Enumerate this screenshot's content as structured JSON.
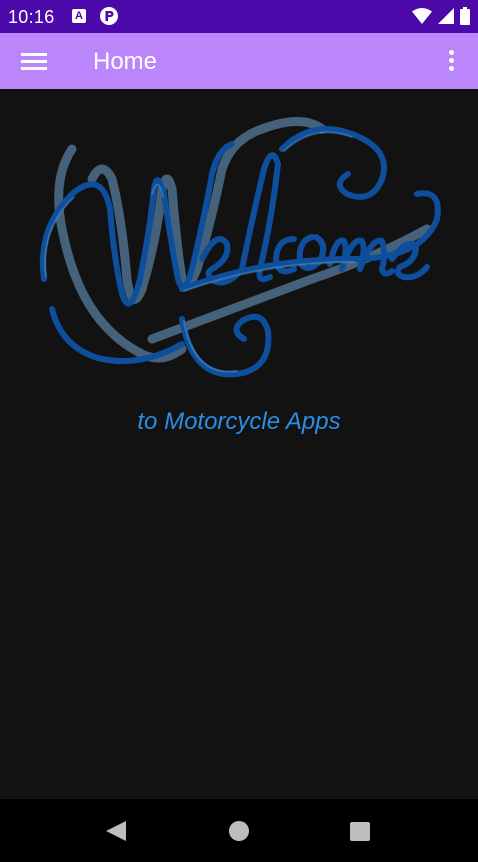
{
  "status_bar": {
    "time": "10:16",
    "notification_a_glyph": "A",
    "icons": [
      "wifi-icon",
      "cellular-signal-icon",
      "battery-icon"
    ]
  },
  "app_bar": {
    "title": "Home",
    "navigation_icon": "hamburger-menu-icon",
    "overflow_icon": "more-vert-icon"
  },
  "main": {
    "welcome_text": "Welcome",
    "subtitle": "to Motorcycle Apps"
  },
  "nav_bar": {
    "buttons": [
      "back-icon",
      "home-icon",
      "recents-icon"
    ]
  },
  "colors": {
    "status_bar": "#4a09a8",
    "app_bar": "#bb86fc",
    "background": "#121212",
    "welcome_blue": "#0d4f9c",
    "subtitle_blue": "#2a8ee6"
  }
}
